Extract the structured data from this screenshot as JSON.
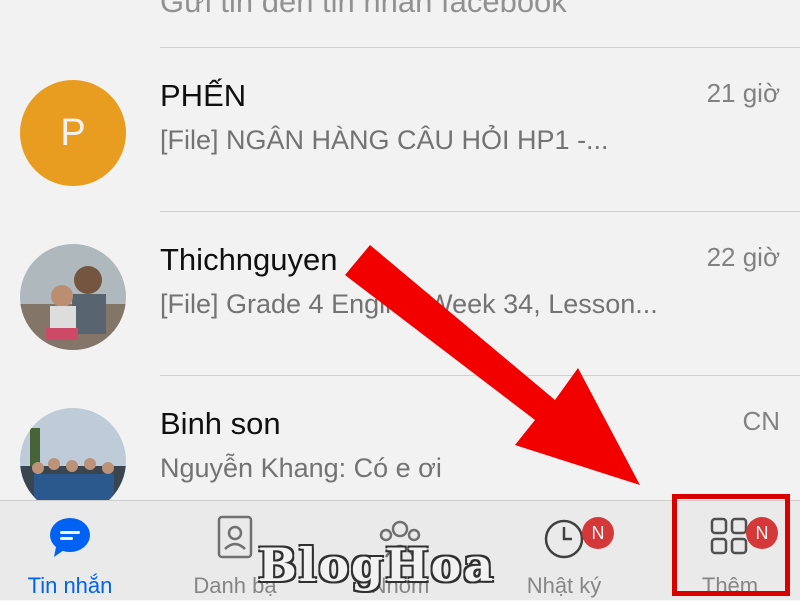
{
  "chat_list": {
    "partial_row_name": "Gửi tin đến tin nhắn facebook",
    "rows": [
      {
        "name": "PHẾN",
        "preview": "[File] NGÂN HÀNG CÂU HỎI HP1 -...",
        "time": "21 giờ",
        "avatar_letter": "P"
      },
      {
        "name": "Thichnguyen",
        "preview": "[File] Grade 4 English Week 34, Lesson...",
        "time": "22 giờ"
      },
      {
        "name": "Binh son",
        "preview": "Nguyễn Khang: Có e ơi",
        "time": "CN"
      }
    ]
  },
  "tab_bar": {
    "tabs": [
      {
        "label": "Tin nhắn",
        "icon": "chat-bubble-icon",
        "active": true
      },
      {
        "label": "Danh bạ",
        "icon": "contacts-icon"
      },
      {
        "label": "Nhóm",
        "icon": "group-icon"
      },
      {
        "label": "Nhật ký",
        "icon": "clock-icon",
        "badge": "N"
      },
      {
        "label": "Thêm",
        "icon": "grid-icon",
        "badge": "N"
      }
    ]
  },
  "watermark": "BlogHoa",
  "colors": {
    "accent": "#0068ff",
    "badge": "#e03b3b",
    "arrow": "#ff0000"
  }
}
